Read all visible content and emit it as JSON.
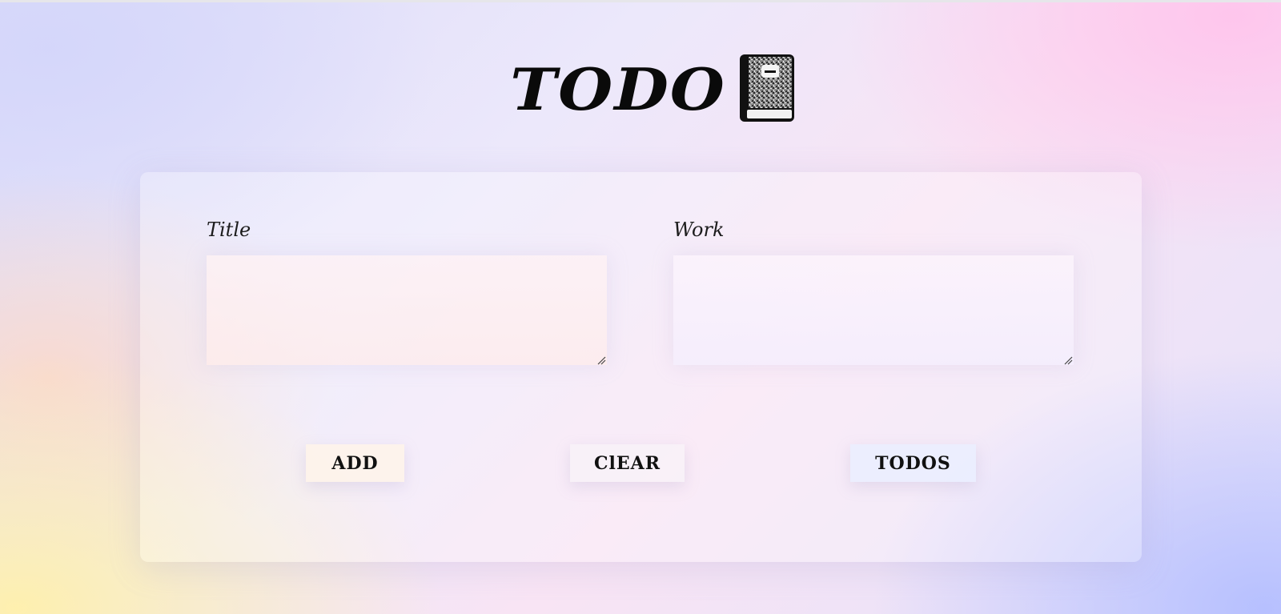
{
  "app": {
    "title": "TODO",
    "icon": "notebook-icon"
  },
  "form": {
    "title_label": "Title",
    "title_value": "",
    "work_label": "Work",
    "work_value": ""
  },
  "actions": {
    "add_label": "ADD",
    "clear_label": "ClEAR",
    "todos_label": "TODOS"
  }
}
